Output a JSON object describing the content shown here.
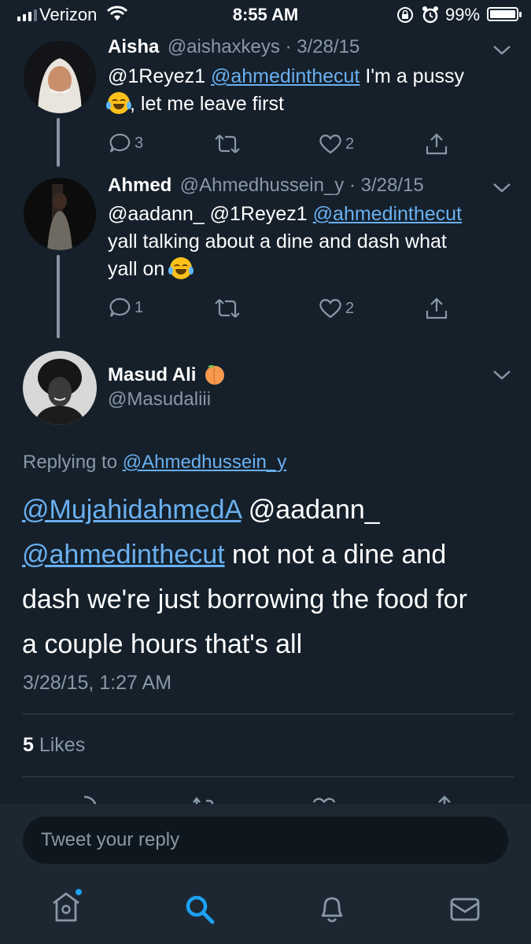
{
  "status_bar": {
    "carrier": "Verizon",
    "time": "8:55 AM",
    "battery": "99%"
  },
  "tweets": [
    {
      "name": "Aisha",
      "handle_date": "@aishaxkeys · 3/28/15",
      "line1_mention": "@1Reyez1 ",
      "line1_link": "@ahmedinthecut",
      "line1_rest": " I'm a pussy",
      "line2_rest": ", let me leave first",
      "replies": "3",
      "likes": "2"
    },
    {
      "name": "Ahmed",
      "handle_date": "@Ahmedhussein_y · 3/28/15",
      "line1_mention": "@aadann_ @1Reyez1 ",
      "line1_link": "@ahmedinthecut",
      "line2": "yall talking about a dine and dash what",
      "line3": "yall on",
      "replies": "1",
      "likes": "2"
    }
  ],
  "main_tweet": {
    "name": "Masud Ali",
    "handle": "@Masudaliii",
    "replying_prefix": "Replying to ",
    "replying_link": "@Ahmedhussein_y",
    "link1": "@MujahidahmedA",
    "text1": " @aadann_",
    "link2": "@ahmedinthecut",
    "text2": " not not a dine and",
    "line3": "dash we're just borrowing the food for",
    "line4": "a couple hours that's all",
    "timestamp": "3/28/15, 1:27 AM",
    "likes_count": "5",
    "likes_label": " Likes"
  },
  "reply_placeholder": "Tweet your reply",
  "tab_bar": [
    "home-icon",
    "search-icon",
    "notifications-icon",
    "messages-icon"
  ],
  "colors": {
    "background": "#15202b",
    "link": "#6ab0f0",
    "accent": "#1da1f2",
    "muted": "#8899a6"
  }
}
